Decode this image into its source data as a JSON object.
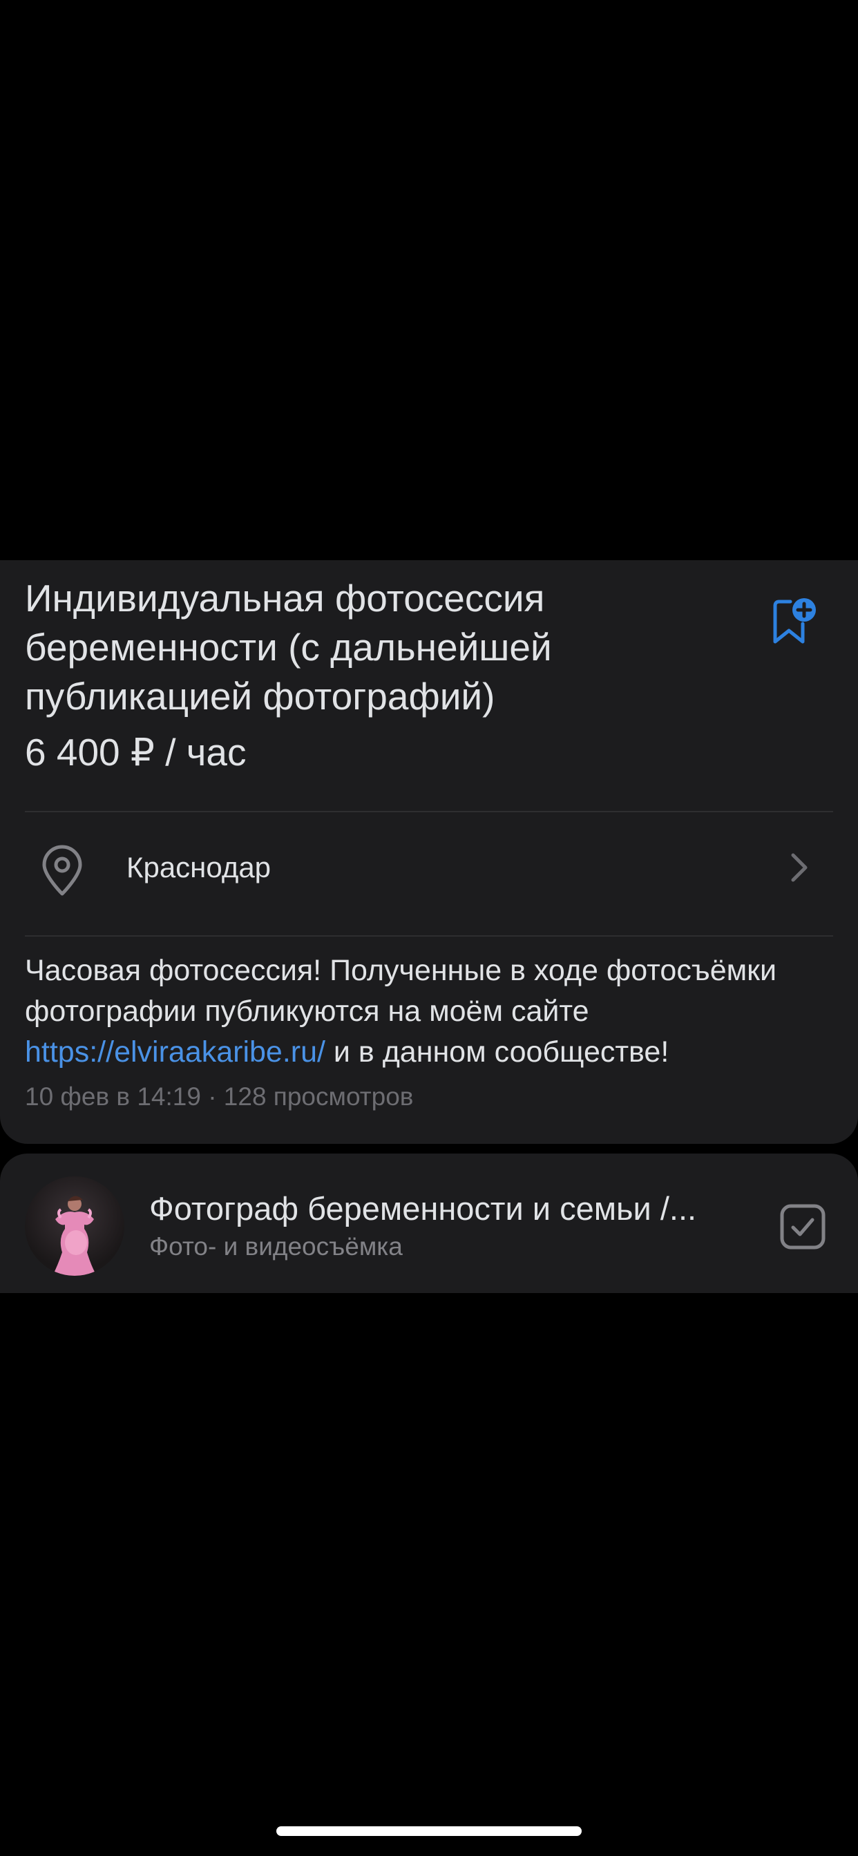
{
  "listing": {
    "title": "Индивидуальная фотосессия беременности (с дальнейшей публикацией фотографий)",
    "price": "6 400 ₽ / час",
    "location": "Краснодар",
    "description_text": "Часовая фотосессия! Полученные в ходе фотосъёмки фотографии публикуются на моём сайте ",
    "description_link": "https://elviraakaribe.ru/",
    "description_tail": " и в данном сообществе!",
    "meta": "10 фев в 14:19 · 128 просмотров"
  },
  "community": {
    "name": "Фотограф беременности и семьи /...",
    "category": "Фото- и видеосъёмка"
  },
  "icons": {
    "bookmark": "bookmark-add-icon",
    "location": "location-pin-icon",
    "chevron": "chevron-right-icon",
    "subscribed": "checkbox-checked-icon"
  },
  "colors": {
    "background": "#000000",
    "card": "#1c1c1e",
    "accent": "#2d81e0",
    "link": "#4a92e6",
    "text_primary": "#e1e3e6",
    "text_secondary": "#6d6d72"
  }
}
